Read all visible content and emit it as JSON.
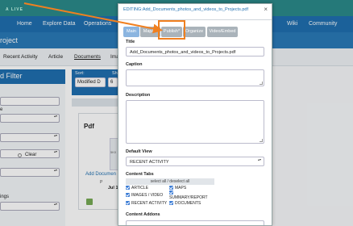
{
  "background": {
    "logo_text": "A LIVE",
    "nav": [
      "Home",
      "Explore Data",
      "Operations",
      "Wiki",
      "Community"
    ],
    "site_title": "roject",
    "tabs": [
      "Recent Activity",
      "Article",
      "Documents",
      "Ima"
    ],
    "filter_title": "d Filter",
    "filter_labels": [
      "e",
      "ings"
    ],
    "clear_label": "Clear",
    "sort_label": "Sort:",
    "sort_label2": "Sh",
    "sort_value": "Modified D",
    "sort_value2": "6",
    "card_title": "Pdf",
    "card_thumb": "5K0",
    "card_link": "Add Documen",
    "card_by": "P",
    "card_date": "Jul 12"
  },
  "modal": {
    "title": "EDITING:Add_Documents_photos_and_videos_to_Projects.pdf",
    "close": "×",
    "tabs": [
      "Main",
      "Map/IP",
      "Publish*",
      "Organize",
      "Video/Embed"
    ],
    "title_label": "Title",
    "title_value": "Add_Documents_photos_and_videos_to_Projects.pdf",
    "caption_label": "Caption",
    "description_label": "Description",
    "default_view_label": "Default View",
    "default_view_value": "RECENT ACTIVITY",
    "content_tabs_label": "Content Tabs",
    "select_all": "select all / deselect all",
    "checkboxes": {
      "article": "ARTICLE",
      "maps": "MAPS",
      "images_video": "IMAGES / VIDEO",
      "summary_report": "SUMMARY/REPORT",
      "recent_activity": "RECENT ACTIVITY",
      "documents": "DOCUMENTS"
    },
    "content_addons_label": "Content Addons"
  },
  "colors": {
    "accent": "#1f6fb0",
    "annotation": "#f08020"
  }
}
